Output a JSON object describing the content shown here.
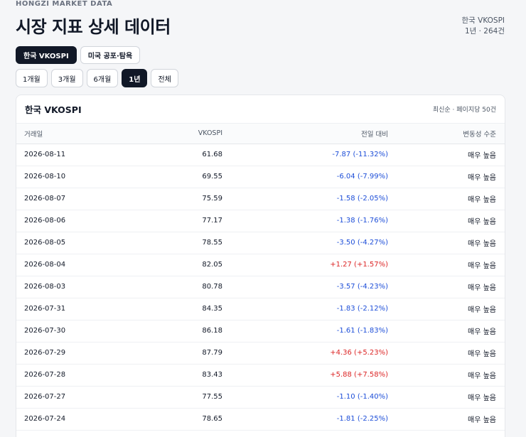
{
  "header": {
    "brand": "HONGZI MARKET DATA",
    "title": "시장 지표 상세 데이터",
    "meta_line1": "한국 VKOSPI",
    "meta_line2": "1년 · 264건"
  },
  "tabs": [
    {
      "label": "한국 VKOSPI",
      "active": true
    },
    {
      "label": "미국 공포·탐욕",
      "active": false
    }
  ],
  "ranges": [
    {
      "label": "1개월",
      "active": false
    },
    {
      "label": "3개월",
      "active": false
    },
    {
      "label": "6개월",
      "active": false
    },
    {
      "label": "1년",
      "active": true
    },
    {
      "label": "전체",
      "active": false
    }
  ],
  "card": {
    "title": "한국 VKOSPI",
    "subtitle": "최신순 · 페이지당 50건"
  },
  "table": {
    "headers": [
      "거래일",
      "VKOSPI",
      "전일 대비",
      "변동성 수준"
    ],
    "rows": [
      {
        "date": "2026-08-11",
        "value": "61.68",
        "change": "-7.87 (-11.32%)",
        "dir": "neg",
        "level": "매우 높음"
      },
      {
        "date": "2026-08-10",
        "value": "69.55",
        "change": "-6.04 (-7.99%)",
        "dir": "neg",
        "level": "매우 높음"
      },
      {
        "date": "2026-08-07",
        "value": "75.59",
        "change": "-1.58 (-2.05%)",
        "dir": "neg",
        "level": "매우 높음"
      },
      {
        "date": "2026-08-06",
        "value": "77.17",
        "change": "-1.38 (-1.76%)",
        "dir": "neg",
        "level": "매우 높음"
      },
      {
        "date": "2026-08-05",
        "value": "78.55",
        "change": "-3.50 (-4.27%)",
        "dir": "neg",
        "level": "매우 높음"
      },
      {
        "date": "2026-08-04",
        "value": "82.05",
        "change": "+1.27 (+1.57%)",
        "dir": "pos",
        "level": "매우 높음"
      },
      {
        "date": "2026-08-03",
        "value": "80.78",
        "change": "-3.57 (-4.23%)",
        "dir": "neg",
        "level": "매우 높음"
      },
      {
        "date": "2026-07-31",
        "value": "84.35",
        "change": "-1.83 (-2.12%)",
        "dir": "neg",
        "level": "매우 높음"
      },
      {
        "date": "2026-07-30",
        "value": "86.18",
        "change": "-1.61 (-1.83%)",
        "dir": "neg",
        "level": "매우 높음"
      },
      {
        "date": "2026-07-29",
        "value": "87.79",
        "change": "+4.36 (+5.23%)",
        "dir": "pos",
        "level": "매우 높음"
      },
      {
        "date": "2026-07-28",
        "value": "83.43",
        "change": "+5.88 (+7.58%)",
        "dir": "pos",
        "level": "매우 높음"
      },
      {
        "date": "2026-07-27",
        "value": "77.55",
        "change": "-1.10 (-1.40%)",
        "dir": "neg",
        "level": "매우 높음"
      },
      {
        "date": "2026-07-24",
        "value": "78.65",
        "change": "-1.81 (-2.25%)",
        "dir": "neg",
        "level": "매우 높음"
      }
    ]
  }
}
